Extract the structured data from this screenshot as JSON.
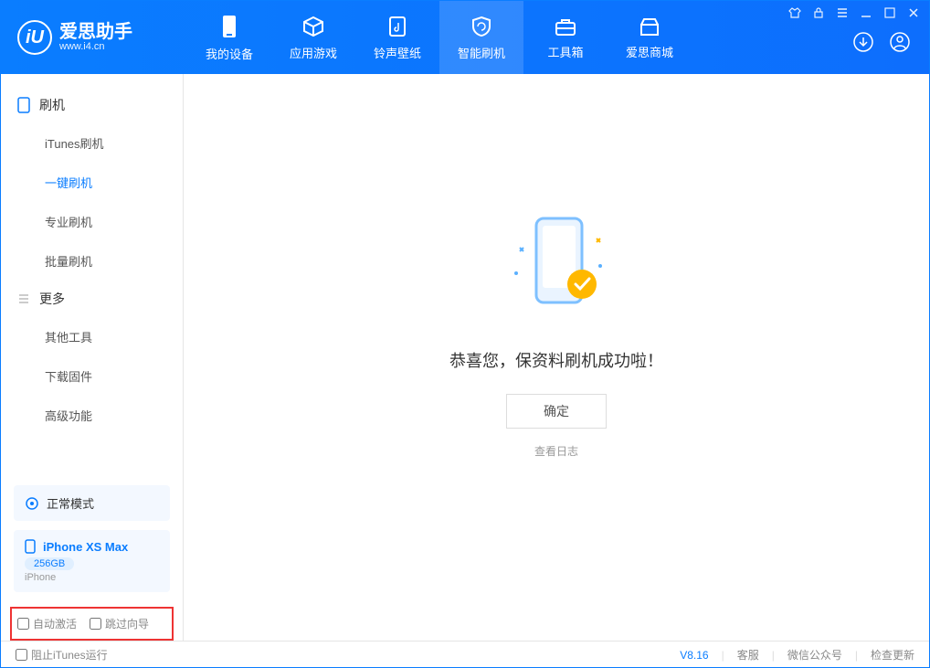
{
  "app": {
    "name": "爱思助手",
    "url": "www.i4.cn",
    "logo_letter": "iU"
  },
  "nav": [
    {
      "label": "我的设备"
    },
    {
      "label": "应用游戏"
    },
    {
      "label": "铃声壁纸"
    },
    {
      "label": "智能刷机"
    },
    {
      "label": "工具箱"
    },
    {
      "label": "爱思商城"
    }
  ],
  "sidebar": {
    "section1_title": "刷机",
    "items1": [
      {
        "label": "iTunes刷机"
      },
      {
        "label": "一键刷机"
      },
      {
        "label": "专业刷机"
      },
      {
        "label": "批量刷机"
      }
    ],
    "section2_title": "更多",
    "items2": [
      {
        "label": "其他工具"
      },
      {
        "label": "下载固件"
      },
      {
        "label": "高级功能"
      }
    ],
    "mode": "正常模式",
    "device_name": "iPhone XS Max",
    "device_capacity": "256GB",
    "device_type": "iPhone",
    "opt_auto_activate": "自动激活",
    "opt_skip_wizard": "跳过向导"
  },
  "content": {
    "success_msg": "恭喜您，保资料刷机成功啦！",
    "confirm": "确定",
    "view_log": "查看日志"
  },
  "footer": {
    "block_itunes": "阻止iTunes运行",
    "version": "V8.16",
    "support": "客服",
    "wechat": "微信公众号",
    "check_update": "检查更新"
  }
}
